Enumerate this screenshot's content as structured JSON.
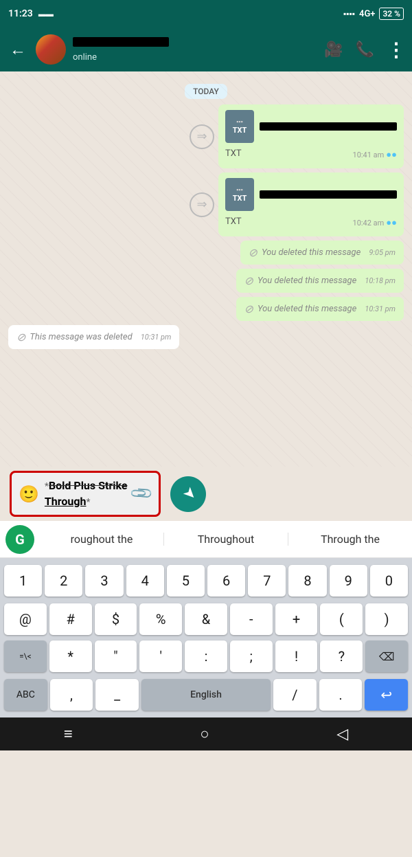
{
  "status": {
    "time": "11:23",
    "signal": "4G+",
    "battery": "32 %"
  },
  "header": {
    "status": "online",
    "video_icon": "📹",
    "call_icon": "📞",
    "more_icon": "⋮"
  },
  "chat": {
    "date_badge": "TODAY",
    "messages": [
      {
        "type": "file",
        "label": "TXT",
        "time": "10:41 am",
        "ticks": "●●"
      },
      {
        "type": "file",
        "label": "TXT",
        "time": "10:42 am",
        "ticks": "●●"
      },
      {
        "type": "deleted_sent",
        "text": "You deleted this message",
        "time": "9:05 pm"
      },
      {
        "type": "deleted_sent",
        "text": "You deleted this message",
        "time": "10:18 pm"
      },
      {
        "type": "deleted_sent",
        "text": "You deleted this message",
        "time": "10:31 pm"
      },
      {
        "type": "deleted_received",
        "text": "This message was deleted",
        "time": "10:31 pm"
      }
    ]
  },
  "input": {
    "text_part1": "Bold Plus Strike",
    "text_part2": "Through",
    "emoji_icon": "🙂",
    "attach_icon": "📎"
  },
  "autocomplete": {
    "grammarly_letter": "G",
    "item1": "roughout the",
    "item2": "Throughout",
    "item3": "Through the"
  },
  "keyboard": {
    "numbers": [
      "1",
      "2",
      "3",
      "4",
      "5",
      "6",
      "7",
      "8",
      "9",
      "0"
    ],
    "symbols1": [
      "@",
      "#",
      "$",
      "%",
      "&",
      "-",
      "+",
      "(",
      ")"
    ],
    "symbols2": [
      "=\\<",
      "*",
      "\"",
      "'",
      ":",
      ";",
      "!",
      "?",
      "⌫"
    ],
    "bottom": {
      "abc": "ABC",
      "comma": ",",
      "underscore": "_",
      "space": "English",
      "slash": "/",
      "period": ".",
      "enter_icon": "↩"
    }
  },
  "navbar": {
    "home": "≡",
    "circle": "○",
    "back": "◁"
  }
}
